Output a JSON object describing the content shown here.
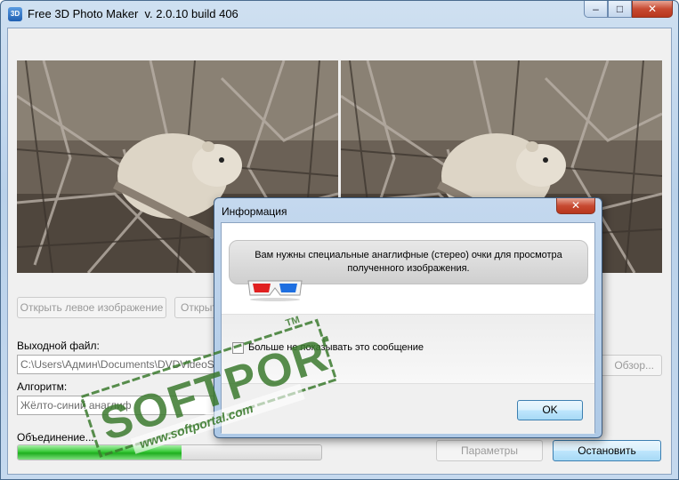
{
  "window": {
    "title": "Free 3D Photo Maker  v. 2.0.10 build 406",
    "icon_text": "3D",
    "minimize_glyph": "–",
    "maximize_glyph": "□",
    "close_glyph": "✕"
  },
  "images": {
    "left_alt": "hyrax-photo-left",
    "right_alt": "hyrax-photo-right"
  },
  "buttons": {
    "open_left": "Открыть левое изображение",
    "open_right": "Открыть",
    "browse": "Обзор...",
    "parameters": "Параметры",
    "stop": "Остановить"
  },
  "output": {
    "label": "Выходной файл:",
    "value": "C:\\Users\\Админ\\Documents\\DVDVideoSoft\\"
  },
  "algorithm": {
    "label": "Алгоритм:",
    "value": "Жёлто-синий анаглиф"
  },
  "progress": {
    "label": "Объединение...",
    "value": 0.54
  },
  "dialog": {
    "title": "Информация",
    "close_glyph": "✕",
    "message_line1": "Вам нужны специальные анаглифные (стерео) очки для просмотра",
    "message_line2": "полученного изображения.",
    "checkbox_label": "Больше не показывать это сообщение",
    "checkbox_checked": false,
    "ok_label": "OK"
  },
  "watermark": {
    "brand": "SOFTPORTAL",
    "url": "www.softportal.com",
    "tm": "TM"
  },
  "colors": {
    "progress_green": "#37c837",
    "anaglyph_red": "#e02020",
    "anaglyph_blue": "#1e6fe0"
  }
}
